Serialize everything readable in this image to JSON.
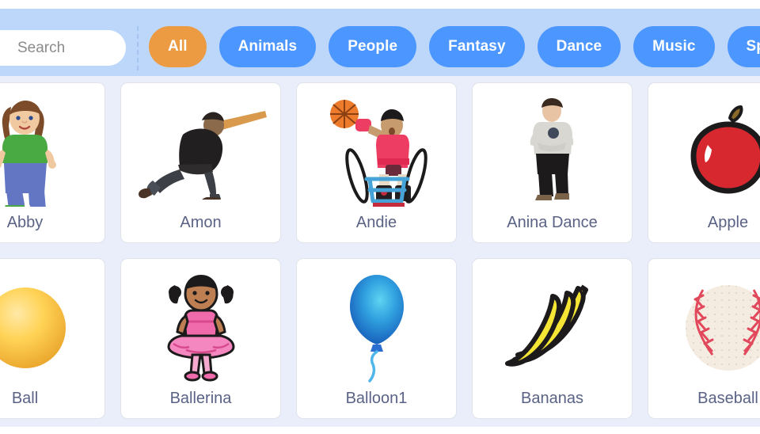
{
  "search": {
    "placeholder": "Search",
    "value": ""
  },
  "categories": [
    {
      "label": "All",
      "active": true
    },
    {
      "label": "Animals",
      "active": false
    },
    {
      "label": "People",
      "active": false
    },
    {
      "label": "Fantasy",
      "active": false
    },
    {
      "label": "Dance",
      "active": false
    },
    {
      "label": "Music",
      "active": false
    },
    {
      "label": "Sports",
      "active": false
    }
  ],
  "sprites": [
    {
      "name": "Abby",
      "art": "abby"
    },
    {
      "name": "Amon",
      "art": "amon"
    },
    {
      "name": "Andie",
      "art": "andie"
    },
    {
      "name": "Anina Dance",
      "art": "anina"
    },
    {
      "name": "Apple",
      "art": "apple"
    },
    {
      "name": "Ball",
      "art": "ball"
    },
    {
      "name": "Ballerina",
      "art": "ballerina"
    },
    {
      "name": "Balloon1",
      "art": "balloon"
    },
    {
      "name": "Bananas",
      "art": "bananas"
    },
    {
      "name": "Baseball",
      "art": "baseball"
    }
  ],
  "colors": {
    "header_bg": "#bdd7fb",
    "grid_bg": "#e9eefa",
    "accent_active": "#ec9b42",
    "accent_button": "#4c97ff",
    "label_text": "#5a6285",
    "card_bg": "#ffffff"
  }
}
